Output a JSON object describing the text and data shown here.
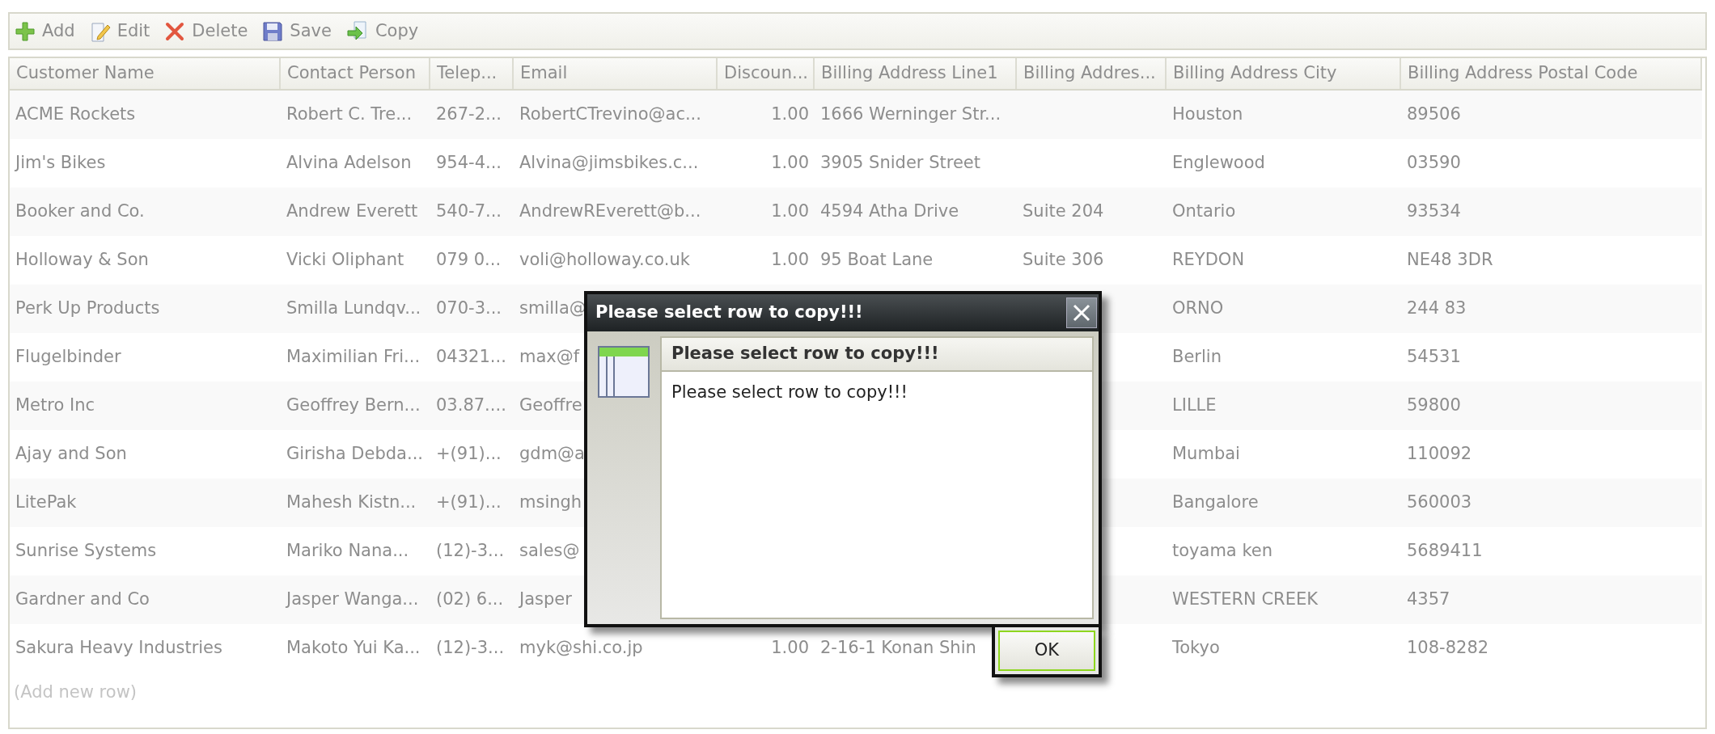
{
  "toolbar": [
    {
      "kind": "add",
      "label": "Add"
    },
    {
      "kind": "edit",
      "label": "Edit"
    },
    {
      "kind": "delete",
      "label": "Delete"
    },
    {
      "kind": "save",
      "label": "Save"
    },
    {
      "kind": "copy",
      "label": "Copy"
    }
  ],
  "table": {
    "columns": [
      "Customer Name",
      "Contact Person",
      "Telep...",
      "Email",
      "Discoun...",
      "Billing Address Line1",
      "Billing Addres...",
      "Billing Address City",
      "Billing Address Postal Code"
    ],
    "rows": [
      {
        "customer_name": "ACME Rockets",
        "contact_person": "Robert C. Tre...",
        "telephone": "267-2...",
        "email": "RobertCTrevino@ac...",
        "discount": "1.00",
        "line1": "1666 Werninger Str...",
        "city": "Houston",
        "postal_code": "89506"
      },
      {
        "customer_name": "Jim's Bikes",
        "contact_person": "Alvina Adelson",
        "telephone": "954-4...",
        "email": "Alvina@jimsbikes.c...",
        "discount": "1.00",
        "line1": "3905 Snider Street",
        "city": "Englewood",
        "postal_code": "03590"
      },
      {
        "customer_name": "Booker and Co.",
        "contact_person": "Andrew Everett",
        "telephone": "540-7...",
        "email": "AndrewREverett@b...",
        "discount": "1.00",
        "line1": "4594 Atha Drive",
        "line2": "Suite 204",
        "city": "Ontario",
        "postal_code": "93534"
      },
      {
        "customer_name": "Holloway & Son",
        "contact_person": "Vicki Oliphant",
        "telephone": "079 0...",
        "email": "voli@holloway.co.uk",
        "discount": "1.00",
        "line1": "95 Boat Lane",
        "line2": "Suite 306",
        "city": "REYDON",
        "postal_code": "NE48 3DR"
      },
      {
        "customer_name": "Perk Up Products",
        "contact_person": "Smilla Lundqv...",
        "telephone": "070-3...",
        "email": "smilla@",
        "city": "ORNO",
        "postal_code": "244 83"
      },
      {
        "customer_name": "Flugelbinder",
        "contact_person": "Maximilian Fri...",
        "telephone": "04321...",
        "email": "max@f",
        "city": "Berlin",
        "postal_code": "54531"
      },
      {
        "customer_name": "Metro Inc",
        "contact_person": "Geoffrey Bern...",
        "telephone": "03.87....",
        "email": "Geoffre",
        "city": "LILLE",
        "postal_code": "59800"
      },
      {
        "customer_name": "Ajay and Son",
        "contact_person": "Girisha Debda...",
        "telephone": "+(91)...",
        "email": "gdm@a",
        "city": "Mumbai",
        "postal_code": "110092"
      },
      {
        "customer_name": "LitePak",
        "contact_person": "Mahesh Kistn...",
        "telephone": "+(91)...",
        "email": "msingh",
        "city": "Bangalore",
        "postal_code": "560003"
      },
      {
        "customer_name": "Sunrise Systems",
        "contact_person": "Mariko Nana...",
        "telephone": "(12)-3...",
        "email": "sales@",
        "city": "toyama ken",
        "postal_code": "5689411"
      },
      {
        "customer_name": "Gardner and Co",
        "contact_person": "Jasper Wanga...",
        "telephone": "(02) 6...",
        "email": "Jasper",
        "city": "WESTERN CREEK",
        "postal_code": "4357"
      },
      {
        "customer_name": "Sakura Heavy Industries",
        "contact_person": "Makoto Yui Ka...",
        "telephone": "(12)-3...",
        "email": "myk@shi.co.jp",
        "discount": "1.00",
        "line1": "2-16-1 Konan Shin",
        "city": "Tokyo",
        "postal_code": "108-8282"
      }
    ],
    "add_new_row": "(Add new row)"
  },
  "dialog": {
    "title": "Please select row to copy!!!",
    "heading": "Please select row to copy!!!",
    "message": "Please select row to copy!!!",
    "ok_button": "OK"
  }
}
